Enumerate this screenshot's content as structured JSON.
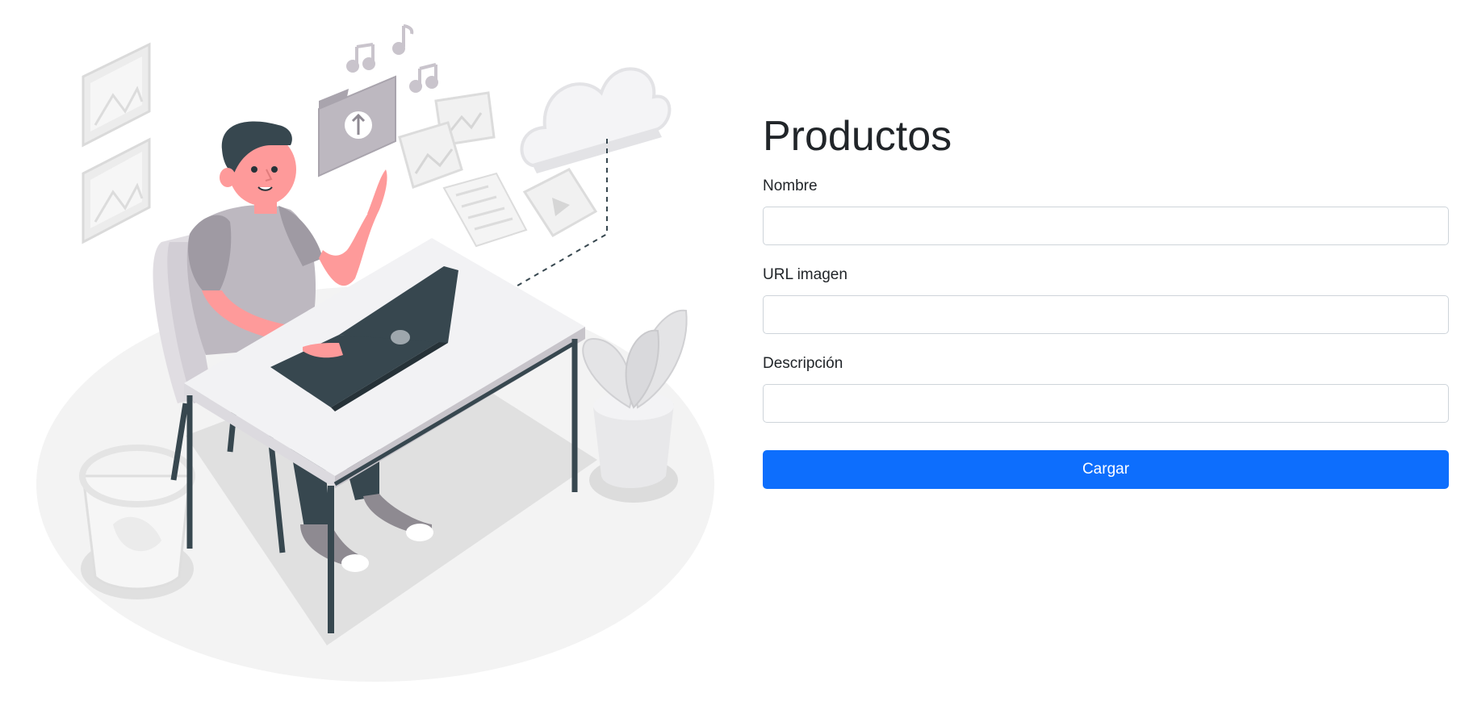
{
  "form": {
    "title": "Productos",
    "fields": [
      {
        "label": "Nombre",
        "value": "",
        "placeholder": ""
      },
      {
        "label": "URL imagen",
        "value": "",
        "placeholder": ""
      },
      {
        "label": "Descripción",
        "value": "",
        "placeholder": ""
      }
    ],
    "submit_label": "Cargar"
  },
  "colors": {
    "accent": "#0d6efd",
    "skin": "#fe9a9a",
    "dark": "#37474f",
    "illustration_gray": "#bdb8c0"
  },
  "illustration": {
    "subject": "person-at-laptop-uploading-files"
  }
}
